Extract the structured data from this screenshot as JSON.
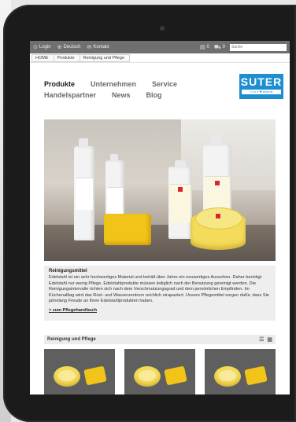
{
  "topbar": {
    "login": "Login",
    "language": "Deutsch",
    "contact": "Kontakt",
    "doc_count": "0",
    "cart_count": "0",
    "search_placeholder": "Suche"
  },
  "breadcrumb": [
    "HOME",
    "Produkte",
    "Reinigung und Pflege"
  ],
  "nav": {
    "row1": [
      "Produkte",
      "Unternehmen",
      "Service"
    ],
    "row2": [
      "Handelspartner",
      "News",
      "Blog"
    ]
  },
  "logo": {
    "name": "SUTER",
    "sub": "i n o x ✚ technik"
  },
  "article": {
    "title": "Reinigungsmittel",
    "body": "Edelstahl ist ein sehr hochwertiges Material und behält über Jahre ein neuwertiges Aussehen. Daher benötigt Edelstahl nur wenig Pflege. Edelstahlprodukte müssen lediglich nach der Benutzung gereinigt werden. Die Reinigungsintervalle richten sich nach dem Verschmutzungsgrad und dem persönlichen Empfinden. Im Küchenalltag wird das Rüst- und Wasserzentrum reichlich strapaziert. Unsere Pflegemittel sorgen dafür, dass Sie jahrelang Freude an Ihren Edelstahlprodukten haben.",
    "link": "> zum Pflegehandbuch"
  },
  "products": {
    "heading": "Reinigung und Pflege",
    "cards": 3
  },
  "colors": {
    "brand": "#1d8fd0",
    "topbar": "#6f6f6f"
  }
}
